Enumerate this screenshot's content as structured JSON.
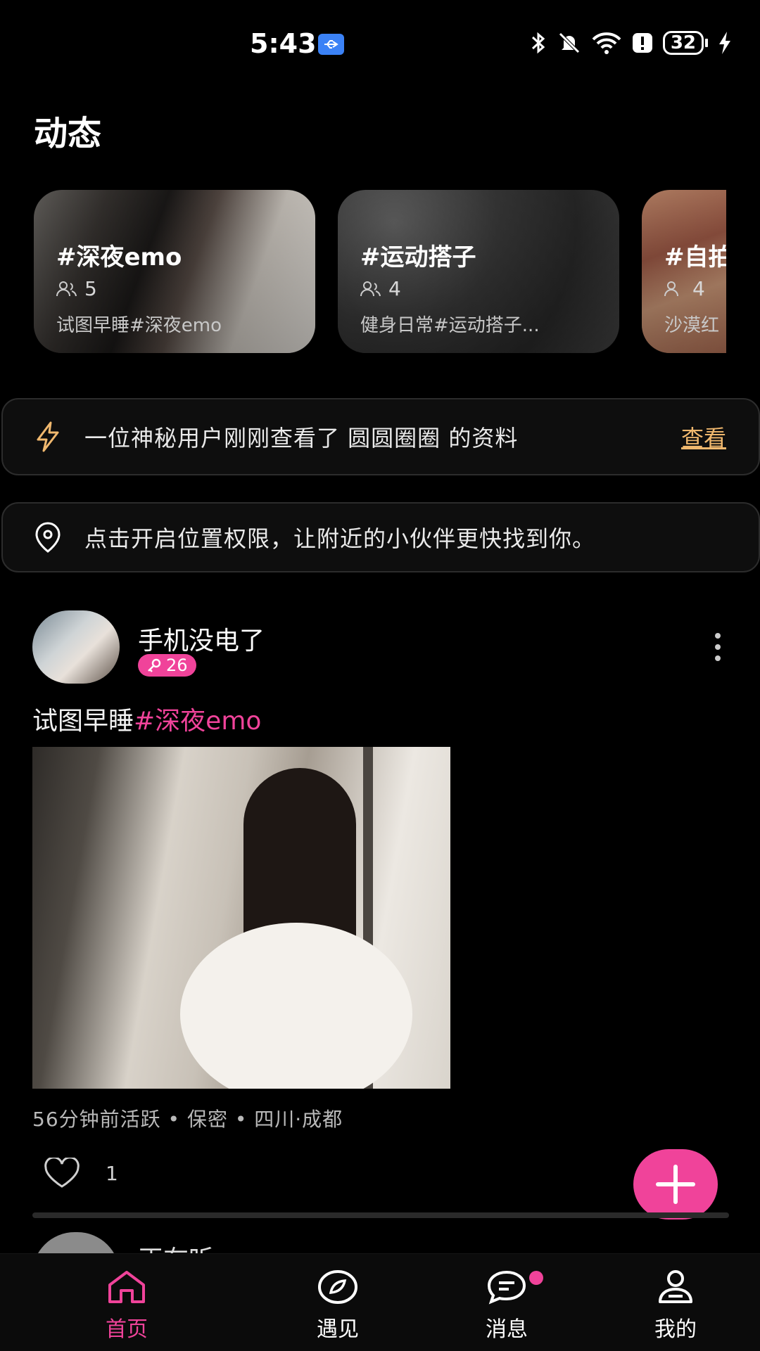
{
  "status_bar": {
    "time": "5:43",
    "battery": "32"
  },
  "page_title": "动态",
  "topic_cards": [
    {
      "title": "#深夜emo",
      "count": "5",
      "desc": "试图早睡#深夜emo"
    },
    {
      "title": "#运动搭子",
      "count": "4",
      "desc": "健身日常#运动搭子..."
    },
    {
      "title": "#自拍",
      "count": "4",
      "desc": "沙漠红"
    }
  ],
  "notices": {
    "visitor_text": "一位神秘用户刚刚查看了 圆圆圈圈 的资料",
    "visitor_action": "查看",
    "location_text": "点击开启位置权限，让附近的小伙伴更快找到你。"
  },
  "post": {
    "username": "手机没电了",
    "badge_value": "26",
    "text_plain": "试图早睡",
    "text_tag": "#深夜emo",
    "meta": "56分钟前活跃 • 保密 • 四川·成都",
    "likes": "1"
  },
  "next_post": {
    "username": "正在听"
  },
  "nav": [
    {
      "label": "首页"
    },
    {
      "label": "遇见"
    },
    {
      "label": "消息"
    },
    {
      "label": "我的"
    }
  ],
  "colors": {
    "accent": "#f0439a",
    "link": "#f0b86e",
    "background": "#000000"
  }
}
